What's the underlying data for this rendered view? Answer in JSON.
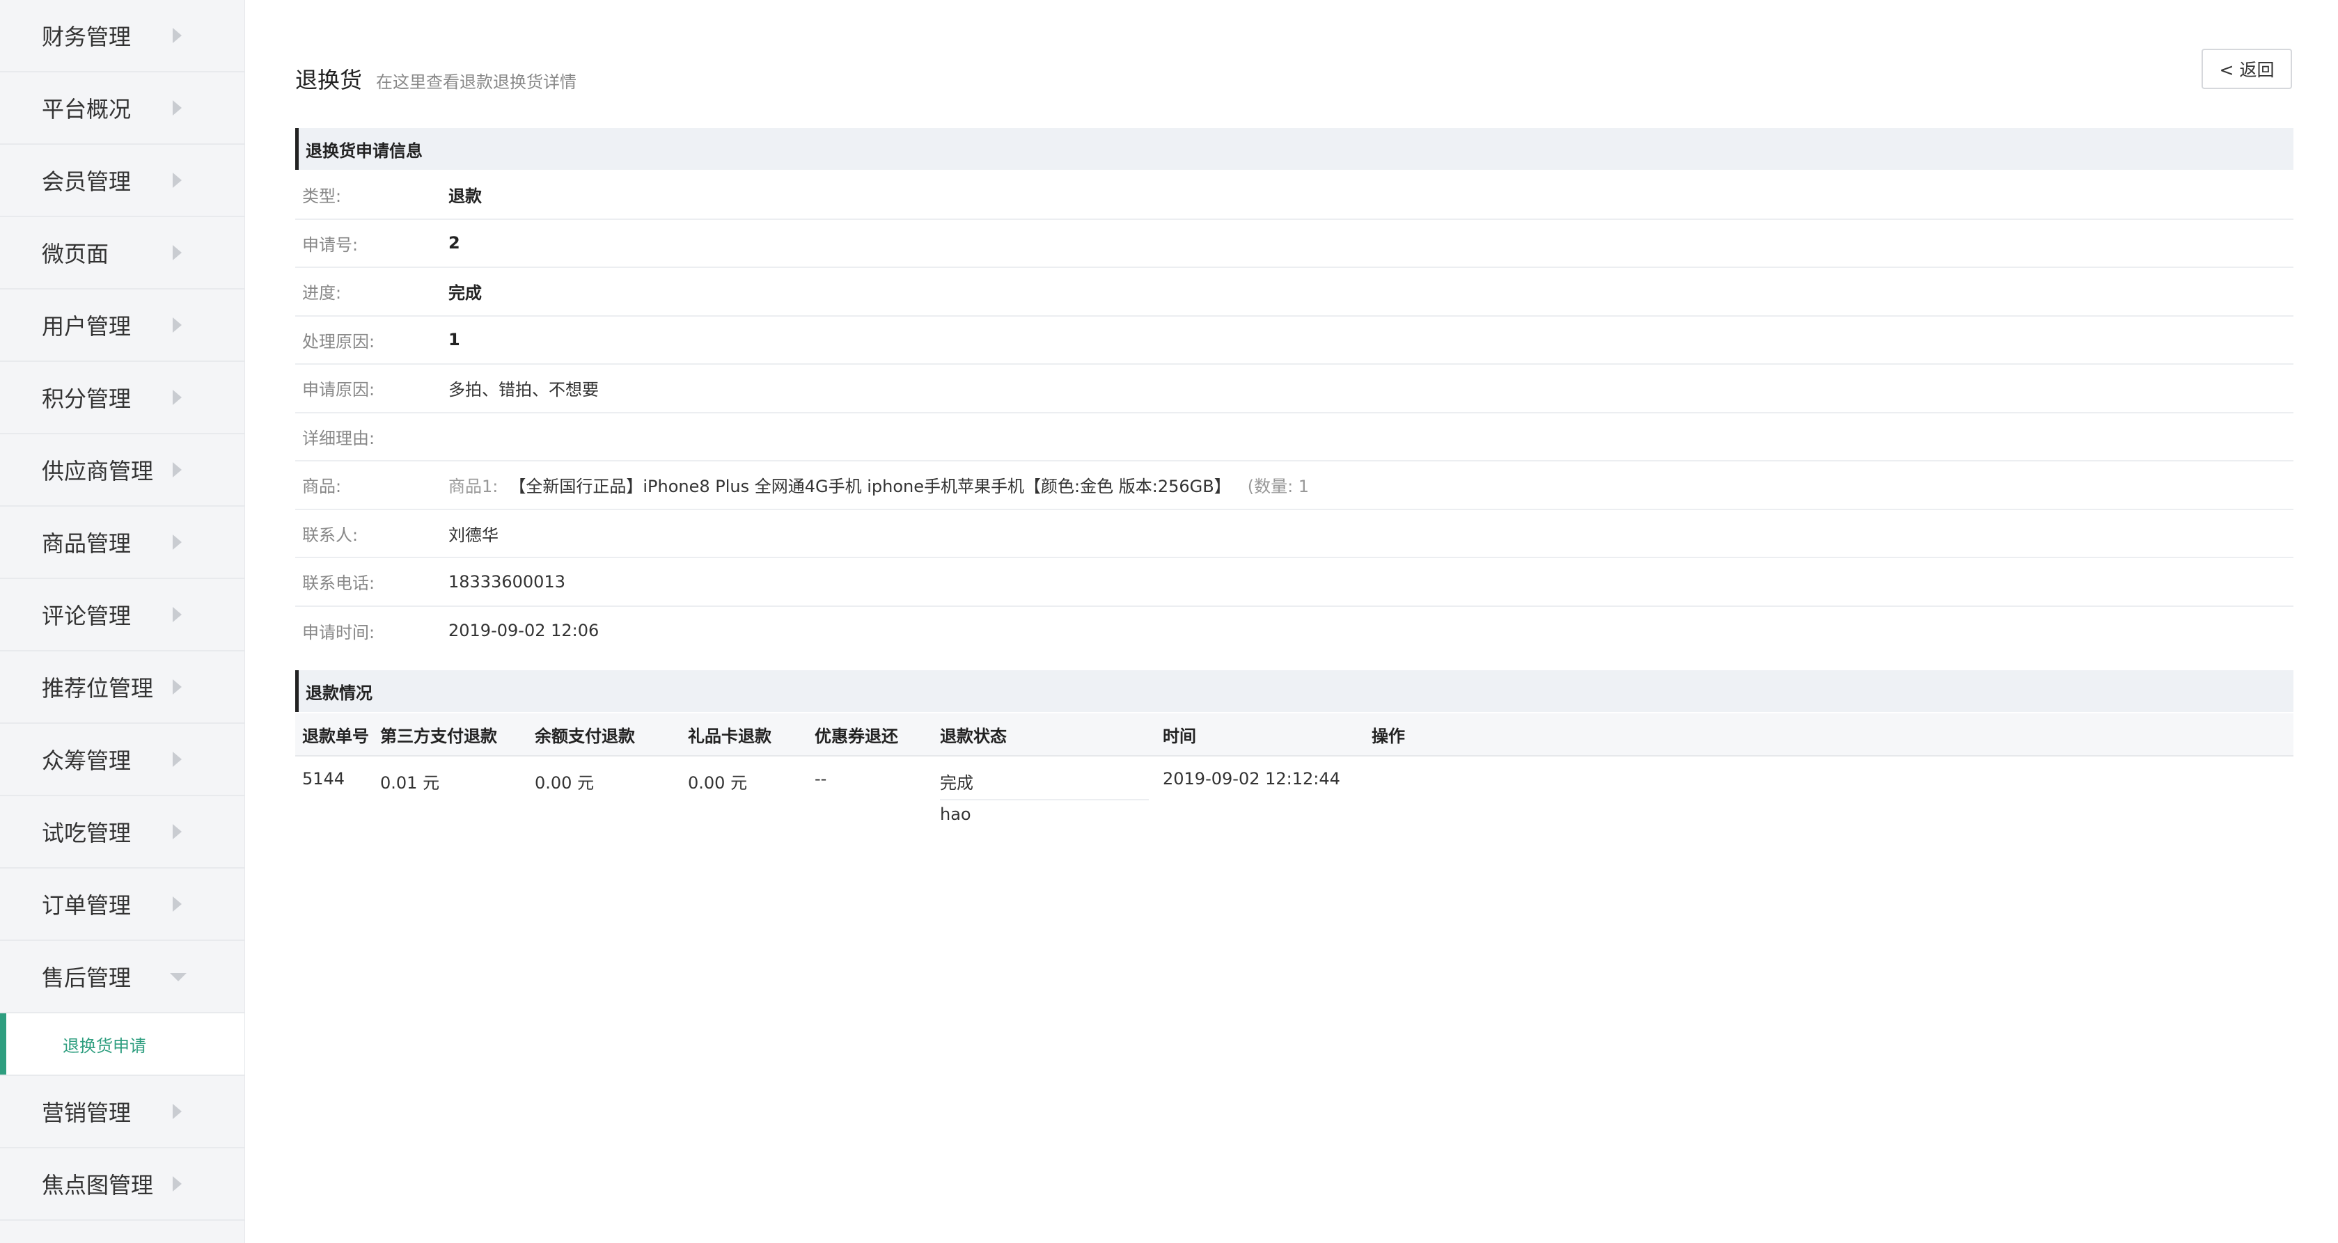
{
  "sidebar": {
    "items": [
      {
        "label": "财务管理"
      },
      {
        "label": "平台概况"
      },
      {
        "label": "会员管理"
      },
      {
        "label": "微页面"
      },
      {
        "label": "用户管理"
      },
      {
        "label": "积分管理"
      },
      {
        "label": "供应商管理"
      },
      {
        "label": "商品管理"
      },
      {
        "label": "评论管理"
      },
      {
        "label": "推荐位管理"
      },
      {
        "label": "众筹管理"
      },
      {
        "label": "试吃管理"
      },
      {
        "label": "订单管理"
      },
      {
        "label": "售后管理"
      },
      {
        "label": "营销管理"
      },
      {
        "label": "焦点图管理"
      }
    ],
    "active_sub": {
      "label": "退换货申请"
    },
    "accent_color": "#2e9e7f"
  },
  "header": {
    "title": "退换货",
    "subtitle": "在这里查看退款退换货详情",
    "back_label": "< 返回"
  },
  "apply_info": {
    "section_title": "退换货申请信息",
    "rows": [
      {
        "label": "类型:",
        "value": "退款"
      },
      {
        "label": "申请号:",
        "value": "2"
      },
      {
        "label": "进度:",
        "value": "完成"
      },
      {
        "label": "处理原因:",
        "value": "1"
      },
      {
        "label": "申请原因:",
        "value": "多拍、错拍、不想要"
      },
      {
        "label": "详细理由:",
        "value": ""
      },
      {
        "label": "商品:",
        "prefix": "商品1:",
        "value": "【全新国行正品】iPhone8 Plus 全网通4G手机 iphone手机苹果手机【颜色:金色 版本:256GB】",
        "qty": "(数量: 1"
      },
      {
        "label": "联系人:",
        "value": "刘德华"
      },
      {
        "label": "联系电话:",
        "value": "18333600013"
      },
      {
        "label": "申请时间:",
        "value": "2019-09-02 12:06"
      }
    ]
  },
  "refund": {
    "section_title": "退款情况",
    "columns": [
      "退款单号",
      "第三方支付退款",
      "余额支付退款",
      "礼品卡退款",
      "优惠券退还",
      "退款状态",
      "时间",
      "操作"
    ],
    "rows": [
      {
        "id": "5144",
        "third_party": "0.01 元",
        "balance": "0.00 元",
        "gift_card": "0.00 元",
        "coupon": "--",
        "status": "完成",
        "status_note": "hao",
        "time": "2019-09-02 12:12:44",
        "action": ""
      }
    ]
  }
}
